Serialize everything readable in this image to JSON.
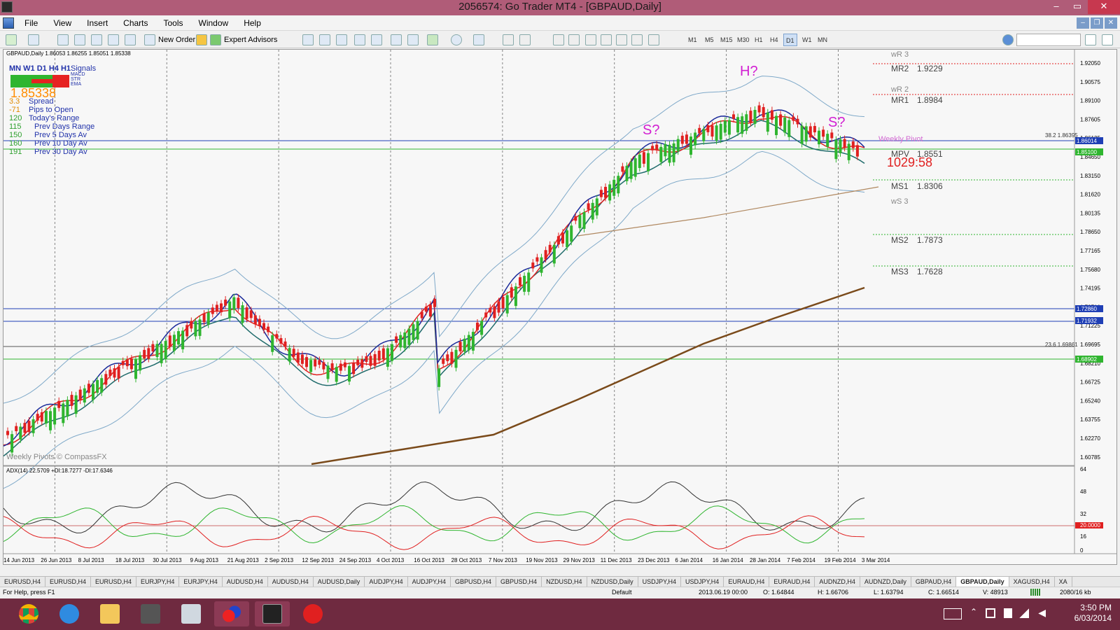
{
  "window": {
    "title": "2056574: Go Trader MT4 - [GBPAUD,Daily]",
    "minimize": "–",
    "maximize": "▭",
    "close": "✕"
  },
  "menu": [
    "File",
    "View",
    "Insert",
    "Charts",
    "Tools",
    "Window",
    "Help"
  ],
  "toolbar": {
    "new_order": "New Order",
    "expert_advisors": "Expert Advisors",
    "timeframes": [
      "M1",
      "M5",
      "M15",
      "M30",
      "H1",
      "H4",
      "D1",
      "W1",
      "MN"
    ],
    "active_timeframe": "D1"
  },
  "chart": {
    "header": "GBPAUD,Daily  1.86053 1.86255 1.85051 1.85338",
    "signals_timeframes": "MN W1 D1  H4  H1",
    "signals_label": "Signals",
    "signal_rows": [
      "MACD",
      "STR",
      "EMA"
    ],
    "price_big": "1.85338",
    "stats": [
      {
        "value": "3.3",
        "label": "Spread"
      },
      {
        "value": "-71",
        "label": "Pips to Open"
      },
      {
        "value": "120",
        "label": "Today's Range"
      },
      {
        "value": "115",
        "label": "Prev Days Range"
      },
      {
        "value": "150",
        "label": "Prev 5 Days Av"
      },
      {
        "value": "160",
        "label": "Prev 10 Day Av"
      },
      {
        "value": "191",
        "label": "Prev 30 Day Av"
      }
    ],
    "watermark": "Weekly Pivots  © CompassFX",
    "annotations": {
      "s1": "S?",
      "h": "H?",
      "s2": "S?"
    },
    "countdown": "1029:58",
    "pivots": [
      {
        "label": "wR 3",
        "value": ""
      },
      {
        "label": "MR2",
        "value": "1.9229"
      },
      {
        "label": "wR 2",
        "value": ""
      },
      {
        "label": "MR1",
        "value": "1.8984"
      },
      {
        "label": "Weekly Pivot",
        "value": ""
      },
      {
        "label": "MPV",
        "value": "1.8551"
      },
      {
        "label": "MS1",
        "value": "1.8306"
      },
      {
        "label": "wS 3",
        "value": ""
      },
      {
        "label": "MS2",
        "value": "1.7873"
      },
      {
        "label": "MS3",
        "value": "1.7628"
      }
    ],
    "fib_labels": [
      "38.2  1.86395",
      "23.6  1.69861"
    ],
    "price_axis": [
      "1.92050",
      "1.90575",
      "1.89100",
      "1.87605",
      "1.86125",
      "1.84650",
      "1.83150",
      "1.81620",
      "1.80135",
      "1.78650",
      "1.77165",
      "1.75680",
      "1.74195",
      "1.72710",
      "1.71225",
      "1.69695",
      "1.68210",
      "1.66725",
      "1.65240",
      "1.63755",
      "1.62270",
      "1.60785"
    ],
    "price_tags": [
      {
        "text": "1.86014",
        "color": "#1f3fb5"
      },
      {
        "text": "1.85100",
        "color": "#2fb52f"
      },
      {
        "text": "1.72860",
        "color": "#1f3fb5"
      },
      {
        "text": "1.71932",
        "color": "#1f3fb5"
      },
      {
        "text": "1.68902",
        "color": "#2fb52f"
      }
    ],
    "adx_label": "ADX(14) 22.5709 +DI:18.7277 -DI:17.6346",
    "adx_axis": [
      "64",
      "48",
      "32",
      "20.0000",
      "16",
      "0"
    ],
    "dates": [
      "14 Jun 2013",
      "26 Jun 2013",
      "8 Jul 2013",
      "18 Jul 2013",
      "30 Jul 2013",
      "9 Aug 2013",
      "21 Aug 2013",
      "2 Sep 2013",
      "12 Sep 2013",
      "24 Sep 2013",
      "4 Oct 2013",
      "16 Oct 2013",
      "28 Oct 2013",
      "7 Nov 2013",
      "19 Nov 2013",
      "29 Nov 2013",
      "11 Dec 2013",
      "23 Dec 2013",
      "6 Jan 2014",
      "16 Jan 2014",
      "28 Jan 2014",
      "7 Feb 2014",
      "19 Feb 2014",
      "3 Mar 2014"
    ]
  },
  "tabs": [
    "EURUSD,H4",
    "EURUSD,H4",
    "EURUSD,H4",
    "EURJPY,H4",
    "EURJPY,H4",
    "AUDUSD,H4",
    "AUDUSD,H4",
    "AUDUSD,Daily",
    "AUDJPY,H4",
    "AUDJPY,H4",
    "GBPUSD,H4",
    "GBPUSD,H4",
    "NZDUSD,H4",
    "NZDUSD,Daily",
    "USDJPY,H4",
    "USDJPY,H4",
    "EURAUD,H4",
    "EURAUD,H4",
    "AUDNZD,H4",
    "AUDNZD,Daily",
    "GBPAUD,H4",
    "GBPAUD,Daily",
    "XAGUSD,H4",
    "XA"
  ],
  "active_tab": "GBPAUD,Daily",
  "status": {
    "help": "For Help, press F1",
    "profile": "Default",
    "datetime": "2013.06.19 00:00",
    "open": "O: 1.64844",
    "high": "H: 1.66706",
    "low": "L: 1.63794",
    "close": "C: 1.66514",
    "volume": "V: 48913",
    "traffic": "2080/16 kb"
  },
  "clock": {
    "time": "3:50 PM",
    "date": "6/03/2014"
  }
}
